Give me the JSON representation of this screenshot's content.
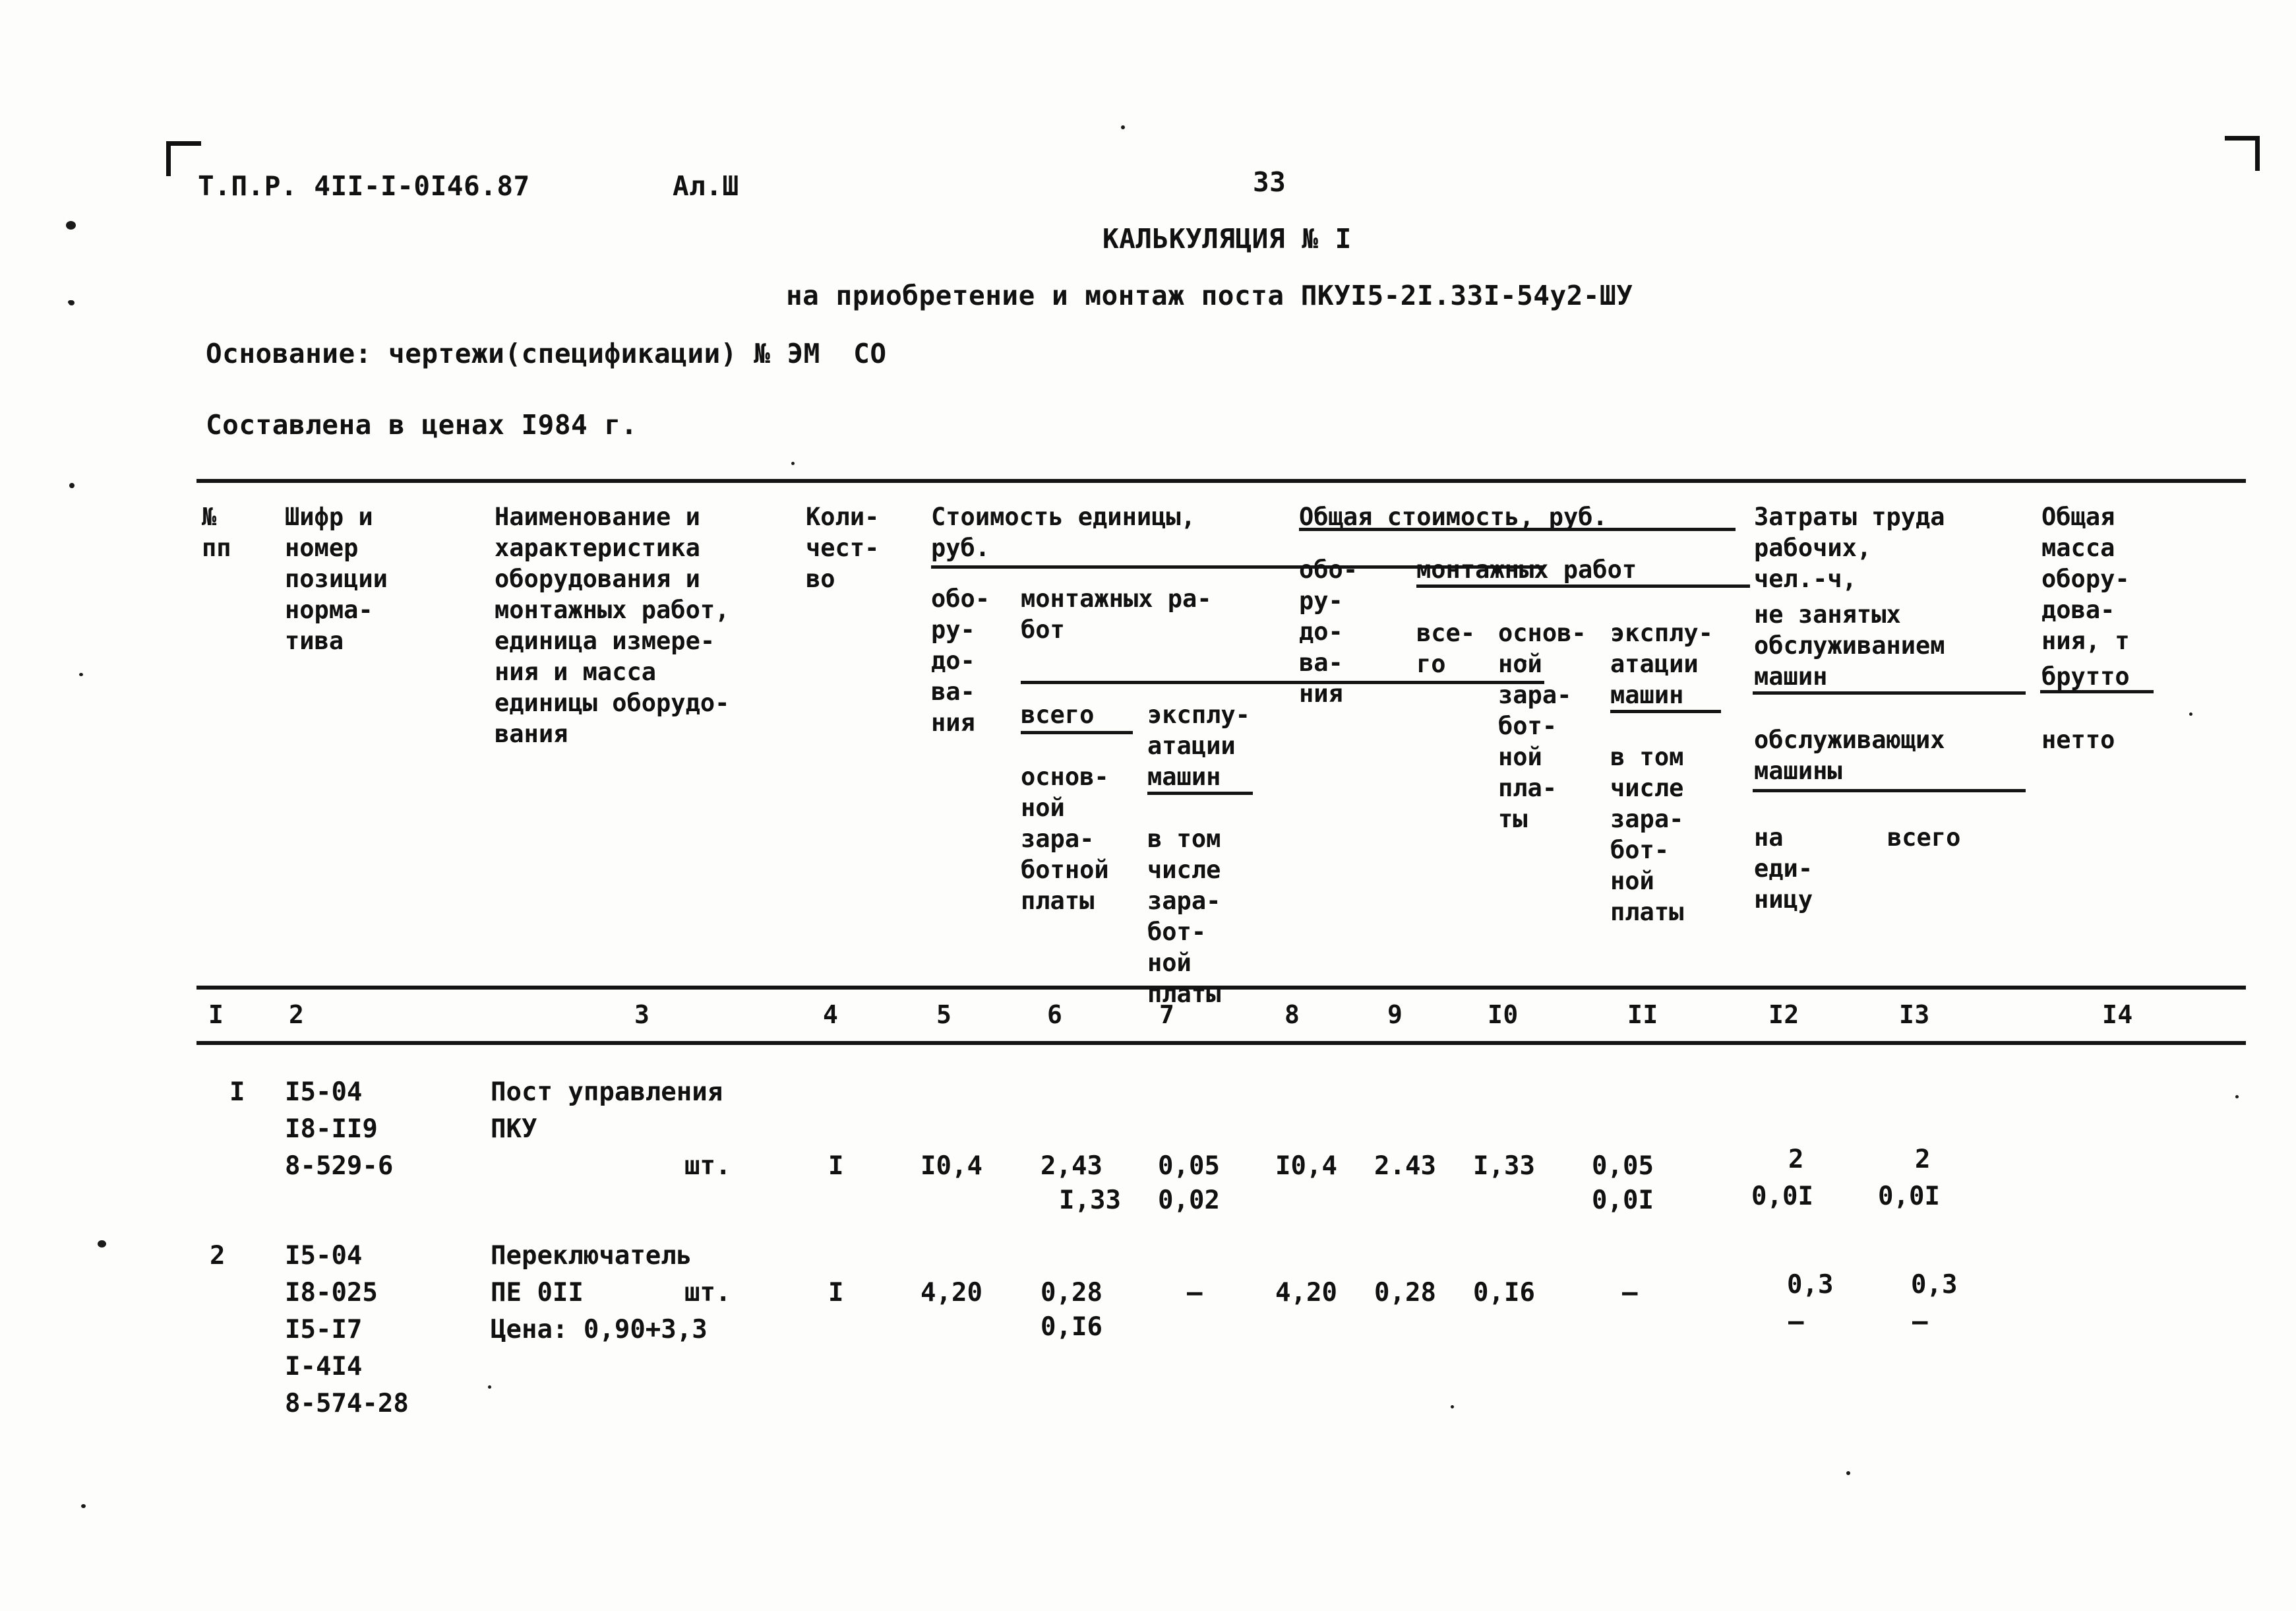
{
  "document": {
    "doc_code": "Т.П.Р. 4II-I-0I46.87",
    "sheet": "Ал.Ш",
    "page_number": "33",
    "calc_title": "КАЛЬКУЛЯЦИЯ № I",
    "subtitle": "на приобретение и монтаж поста ПКУI5-2I.33I-54у2-ШУ",
    "basis": "Основание: чертежи(спецификации) № ЭМ  СО",
    "prices": "Составлена в ценах I984 г."
  },
  "table": {
    "headers": {
      "col1": "№\nпп",
      "col2": "Шифр и\nномер\nпозиции\nнорма-\nтива",
      "col3": "Наименование и\nхарактеристика\nоборудования и\nмонтажных работ,\nединица измере-\nния и масса\nединицы оборудо-\nвания",
      "col4": "Коли-\nчест-\nво",
      "col5_group": "Стоимость единицы,\nруб.",
      "col5": "обо-\nру-\nдо-\nва-\nния",
      "col6_group": "монтажных ра-\nбот",
      "col6": "всего\n\nоснов-\nной\nзара-\nботной\nплаты",
      "col7": "эксплу-\nатации\nмашин\n\nв том\nчисле\nзара-\nбот-\nной\nплаты",
      "col8_group": "Общая стоимость, руб.",
      "col8": "обо-\nру-\nдо-\nва-\nния",
      "col9_group": "монтажных работ",
      "col9": "все-\nго",
      "col10": "основ-\nной\nзара-\nбот-\nной\nпла-\nты",
      "col11": "эксплу-\nатации\nмашин\n\nв том\nчисле\nзара-\nбот-\nной\nплаты",
      "col12_group": "Затраты труда\nрабочих,\nчел.-ч,",
      "col12a": "не занятых\nобслуживанием\nмашин",
      "col12b": "обслуживающих\nмашины",
      "col12c": "на\nеди-\nницу",
      "col13c": "всего",
      "col14": "Общая\nмасса\nоборy-\nдова-\nния, т",
      "col14a": "брутто",
      "col14b": "нетто"
    },
    "column_numbers": [
      "I",
      "2",
      "3",
      "4",
      "5",
      "6",
      "7",
      "8",
      "9",
      "I0",
      "II",
      "I2",
      "I3",
      "I4"
    ],
    "rows": [
      {
        "num": "I",
        "codes": "I5-04\nI8-II9\n8-529-6",
        "name": "Пост управления\nПКУ",
        "unit": "шт.",
        "qty": "I",
        "c5": "I0,4",
        "c6_top": "2,43",
        "c6_bot": "I,33",
        "c7_top": "0,05",
        "c7_bot": "0,02",
        "c8": "I0,4",
        "c9": "2.43",
        "c10": "I,33",
        "c11_top": "0,05",
        "c11_bot": "0,0I",
        "c12_top": "2",
        "c12_bot": "0,0I",
        "c13_top": "2",
        "c13_bot": "0,0I",
        "c14": ""
      },
      {
        "num": "2",
        "codes": "I5-04\nI8-025\nI5-I7\nI-4I4\n8-574-28",
        "name": "Переключатель\nПЕ 0II",
        "price_note": "Цена: 0,90+3,3",
        "unit": "шт.",
        "qty": "I",
        "c5": "4,20",
        "c6_top": "0,28",
        "c6_bot": "0,I6",
        "c7_top": "–",
        "c7_bot": "",
        "c8": "4,20",
        "c9": "0,28",
        "c10": "0,I6",
        "c11_top": "–",
        "c11_bot": "",
        "c12_top": "0,3",
        "c12_bot": "–",
        "c13_top": "0,3",
        "c13_bot": "–",
        "c14": ""
      }
    ]
  }
}
